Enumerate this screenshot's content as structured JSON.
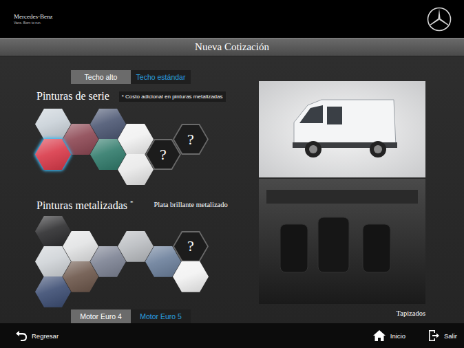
{
  "header": {
    "brand": "Mercedes-Benz",
    "tagline": "Vans. Born to run."
  },
  "title": "Nueva Cotización",
  "roof_tabs": [
    {
      "label": "Techo alto",
      "selected": true
    },
    {
      "label": "Techo estándar",
      "selected": false
    }
  ],
  "standard_paints": {
    "heading": "Pinturas de serie",
    "note": "* Costo adicional en pinturas metalizadas",
    "swatches": [
      {
        "kind": "color",
        "color": "#c9d1d8",
        "selected": false
      },
      {
        "kind": "color",
        "color": "#8c4652",
        "selected": false
      },
      {
        "kind": "color",
        "color": "#4b5672",
        "selected": false
      },
      {
        "kind": "color",
        "color": "#d93848",
        "selected": true
      },
      {
        "kind": "color",
        "color": "#2f7a6a",
        "selected": false
      },
      {
        "kind": "color",
        "color": "#f1f1f1",
        "selected": false
      },
      {
        "kind": "unknown",
        "label": "?",
        "selected": false
      },
      {
        "kind": "unknown",
        "label": "?",
        "selected": false
      },
      {
        "kind": "color",
        "color": "#e9e9e9",
        "selected": false
      }
    ]
  },
  "metallic_paints": {
    "heading": "Pinturas metalizadas",
    "mark": "*",
    "current": "Plata brillante metalizado",
    "swatches": [
      {
        "kind": "color",
        "color": "#2b2b2d",
        "selected": false
      },
      {
        "kind": "color",
        "color": "#e2e3e4",
        "selected": false
      },
      {
        "kind": "color",
        "color": "#cfd3d7",
        "selected": false
      },
      {
        "kind": "color",
        "color": "#6b5549",
        "selected": false
      },
      {
        "kind": "color",
        "color": "#7b8192",
        "selected": false
      },
      {
        "kind": "color",
        "color": "#b9bcc0",
        "selected": false
      },
      {
        "kind": "color",
        "color": "#6a7e9a",
        "selected": false
      },
      {
        "kind": "unknown",
        "label": "?",
        "selected": false
      },
      {
        "kind": "color",
        "color": "#f2f2f2",
        "selected": false
      },
      {
        "kind": "color",
        "color": "#3b4c72",
        "selected": false
      }
    ]
  },
  "engine_tabs": [
    {
      "label": "Motor Euro 4",
      "selected": true
    },
    {
      "label": "Motor Euro 5",
      "selected": false
    }
  ],
  "upholstery_label": "Tapizados",
  "footer": {
    "back": "Regresar",
    "home": "Inicio",
    "exit": "Salir"
  }
}
